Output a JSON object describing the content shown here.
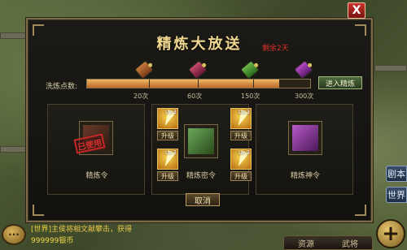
{
  "dialog": {
    "title": "精炼大放送",
    "remaining": "剩余2天",
    "close_label": "X",
    "progress": {
      "label": "洗炼点数:",
      "value_fraction": 0.86,
      "ticks": [
        "20次",
        "60次",
        "150次",
        "300次"
      ],
      "enter_button": "进入精炼"
    },
    "cards": [
      {
        "label": "精炼令",
        "stamp": "已使用"
      },
      {
        "label": "精炼密令"
      },
      {
        "label": "精炼神令"
      }
    ],
    "slots": [
      {
        "level": "Lv.3",
        "button": "升级"
      },
      {
        "level": "Lv.3",
        "button": "升级"
      },
      {
        "level": "Lv.3",
        "button": "升级"
      },
      {
        "level": "Lv.3",
        "button": "升级"
      }
    ],
    "cancel_button": "取消"
  },
  "chat": {
    "channel": "[世界]",
    "message": "主侯将相文献攀击，获得",
    "currency": "999999银币"
  },
  "bottom_tabs": [
    "资源",
    "武将"
  ],
  "side_buttons": [
    "剧本",
    "世界"
  ],
  "colors": {
    "accent": "#f0d890",
    "gold": "#e8c870",
    "red": "#e0302a"
  }
}
